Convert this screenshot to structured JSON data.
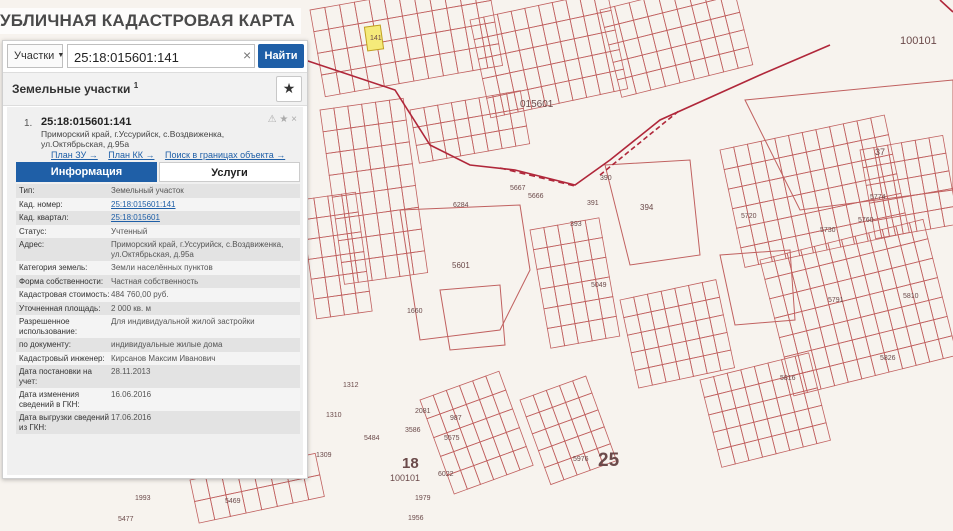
{
  "app": {
    "title": "УБЛИЧНАЯ КАДАСТРОВАЯ КАРТА"
  },
  "search": {
    "type_label": "Участки",
    "value": "25:18:015601:141",
    "clear_glyph": "×",
    "button_label": "Найти"
  },
  "section": {
    "title": "Земельные участки",
    "count": "1",
    "favorite_glyph": "★"
  },
  "result": {
    "index": "1.",
    "number": "25:18:015601:141",
    "action_glyphs": "⚠ ★ ×",
    "address": "Приморский край, г.Уссурийск, с.Воздвиженка, ул.Октябрьская, д.95а",
    "links": [
      "План ЗУ →",
      "План КК →",
      "Поиск в границах объекта →"
    ]
  },
  "tabs": [
    {
      "label": "Информация"
    },
    {
      "label": "Услуги"
    }
  ],
  "info_rows": [
    {
      "key": "Тип:",
      "value": "Земельный участок"
    },
    {
      "key": "Кад. номер:",
      "value": "25:18:015601:141"
    },
    {
      "key": "Кад. квартал:",
      "value": "25:18:015601"
    },
    {
      "key": "Статус:",
      "value": "Учтенный"
    },
    {
      "key": "Адрес:",
      "value": "Приморский край, г.Уссурийск, с.Воздвиженка, ул.Октябрьская, д.95а"
    },
    {
      "key": "Категория земель:",
      "value": "Земли населённых пунктов"
    },
    {
      "key": "Форма собственности:",
      "value": "Частная собственность"
    },
    {
      "key": "Кадастровая стоимость:",
      "value": "484 760,00 руб."
    },
    {
      "key": "Уточненная площадь:",
      "value": "2 000 кв. м"
    },
    {
      "key": "Разрешенное использование:",
      "value": "Для индивидуальной жилой застройки"
    },
    {
      "key": "по документу:",
      "value": "индивидуальные жилые дома"
    },
    {
      "key": "Кадастровый инженер:",
      "value": "Кирсанов Максим Иванович"
    },
    {
      "key": "Дата постановки на учет:",
      "value": "28.11.2013"
    },
    {
      "key": "Дата изменения сведений в ГКН:",
      "value": "16.06.2016"
    },
    {
      "key": "Дата выгрузки сведений из ГКН:",
      "value": "17.06.2016"
    }
  ],
  "map": {
    "colors": {
      "parcel_stroke": "#c0605f",
      "selected_fill": "#f5ea7a",
      "boundary_line": "#b0273a",
      "background": "#f7f3ee"
    },
    "labels": [
      {
        "text": "100101"
      },
      {
        "text": "015601"
      },
      {
        "text": "37"
      },
      {
        "text": "394"
      },
      {
        "text": "5601"
      },
      {
        "text": "391"
      },
      {
        "text": "393"
      },
      {
        "text": "390"
      },
      {
        "text": "25"
      },
      {
        "text": "18"
      },
      {
        "text": "100101"
      },
      {
        "text": "6284"
      },
      {
        "text": "1312"
      },
      {
        "text": "1310"
      },
      {
        "text": "1309"
      },
      {
        "text": "5484"
      },
      {
        "text": "5976"
      },
      {
        "text": "1993"
      },
      {
        "text": "5469"
      },
      {
        "text": "5477"
      },
      {
        "text": "3586"
      },
      {
        "text": "2081"
      },
      {
        "text": "987"
      },
      {
        "text": "5575"
      },
      {
        "text": "6022"
      },
      {
        "text": "1979"
      },
      {
        "text": "1956"
      },
      {
        "text": "5667"
      },
      {
        "text": "5666"
      },
      {
        "text": "5049"
      },
      {
        "text": "1660"
      },
      {
        "text": "141"
      },
      {
        "text": "5720"
      },
      {
        "text": "5730"
      },
      {
        "text": "5816"
      },
      {
        "text": "5826"
      },
      {
        "text": "5791"
      },
      {
        "text": "5810"
      },
      {
        "text": "5774"
      },
      {
        "text": "5760"
      }
    ]
  }
}
